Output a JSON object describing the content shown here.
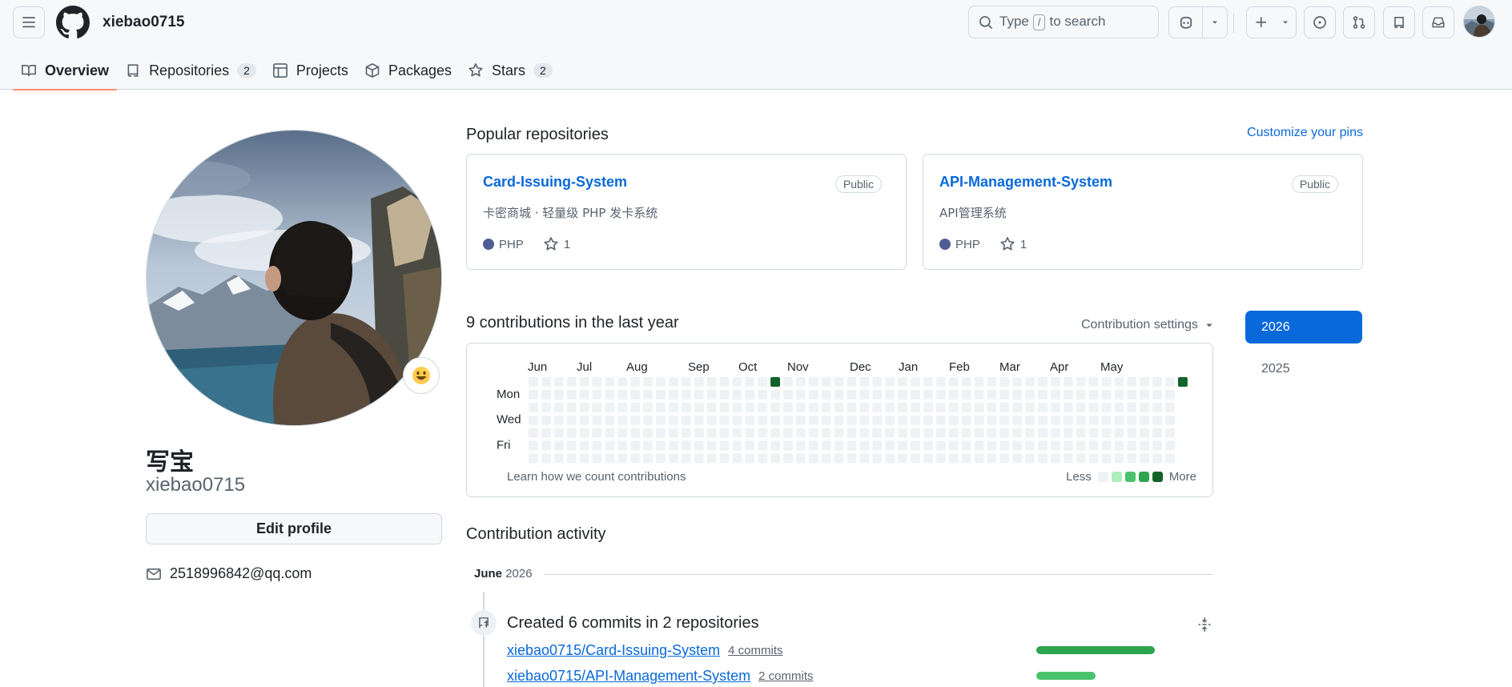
{
  "header": {
    "username": "xiebao0715",
    "search": {
      "prefix": "Type",
      "key": "/",
      "suffix": "to search"
    }
  },
  "tabs": [
    {
      "label": "Overview",
      "count": ""
    },
    {
      "label": "Repositories",
      "count": "2"
    },
    {
      "label": "Projects",
      "count": ""
    },
    {
      "label": "Packages",
      "count": ""
    },
    {
      "label": "Stars",
      "count": "2"
    }
  ],
  "profile": {
    "display_name": "写宝",
    "login": "xiebao0715",
    "edit_label": "Edit profile",
    "email": "2518996842@qq.com"
  },
  "popular": {
    "title": "Popular repositories",
    "customize": "Customize your pins",
    "repos": [
      {
        "name": "Card-Issuing-System",
        "visibility": "Public",
        "desc": "卡密商城 · 轻量级 PHP 发卡系统",
        "lang": "PHP",
        "stars": "1"
      },
      {
        "name": "API-Management-System",
        "visibility": "Public",
        "desc": "API管理系统",
        "lang": "PHP",
        "stars": "1"
      }
    ]
  },
  "contrib": {
    "title": "9 contributions in the last year",
    "settings": "Contribution settings",
    "months": [
      "Jun",
      "Jul",
      "Aug",
      "Sep",
      "Oct",
      "Nov",
      "Dec",
      "Jan",
      "Feb",
      "Mar",
      "Apr",
      "May"
    ],
    "days": [
      "Mon",
      "Wed",
      "Fri"
    ],
    "learn": "Learn how we count contributions",
    "less": "Less",
    "more": "More",
    "years": [
      "2026",
      "2025"
    ],
    "colors": {
      "empty": "#eff2f5",
      "l1": "#aceebb",
      "l2": "#4ac26b",
      "l3": "#2da44e",
      "l4": "#116329"
    }
  },
  "activity": {
    "title": "Contribution activity",
    "month_bold": "June",
    "month_year": "2026",
    "summary": "Created 6 commits in 2 repositories",
    "rows": [
      {
        "repo": "xiebao0715/Card-Issuing-System",
        "commits": "4 commits",
        "share": 0.67
      },
      {
        "repo": "xiebao0715/API-Management-System",
        "commits": "2 commits",
        "share": 0.33
      }
    ]
  }
}
